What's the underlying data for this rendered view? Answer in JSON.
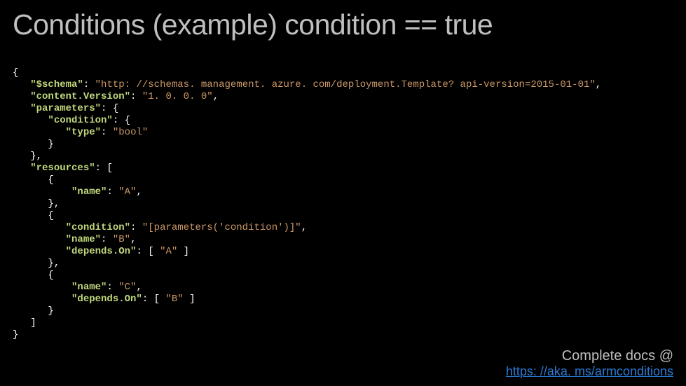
{
  "title": "Conditions  (example) condition == true",
  "code": {
    "lines": [
      [
        {
          "t": "punc",
          "v": "{"
        }
      ],
      [
        {
          "t": "indent",
          "v": "   "
        },
        {
          "t": "key",
          "v": "\"$schema\""
        },
        {
          "t": "punc",
          "v": ": "
        },
        {
          "t": "str",
          "v": "\"http: //schemas. management. azure. com/deployment.Template? api-version=2015-01-01\""
        },
        {
          "t": "punc",
          "v": ","
        }
      ],
      [
        {
          "t": "indent",
          "v": "   "
        },
        {
          "t": "key",
          "v": "\"content.Version\""
        },
        {
          "t": "punc",
          "v": ": "
        },
        {
          "t": "str",
          "v": "\"1. 0. 0. 0\""
        },
        {
          "t": "punc",
          "v": ","
        }
      ],
      [
        {
          "t": "indent",
          "v": "   "
        },
        {
          "t": "key",
          "v": "\"parameters\""
        },
        {
          "t": "punc",
          "v": ": {"
        }
      ],
      [
        {
          "t": "indent",
          "v": "      "
        },
        {
          "t": "key",
          "v": "\"condition\""
        },
        {
          "t": "punc",
          "v": ": {"
        }
      ],
      [
        {
          "t": "indent",
          "v": "         "
        },
        {
          "t": "key",
          "v": "\"type\""
        },
        {
          "t": "punc",
          "v": ": "
        },
        {
          "t": "str",
          "v": "\"bool\""
        }
      ],
      [
        {
          "t": "indent",
          "v": "      "
        },
        {
          "t": "punc",
          "v": "}"
        }
      ],
      [
        {
          "t": "indent",
          "v": "   "
        },
        {
          "t": "punc",
          "v": "},"
        }
      ],
      [
        {
          "t": "indent",
          "v": "   "
        },
        {
          "t": "key",
          "v": "\"resources\""
        },
        {
          "t": "punc",
          "v": ": ["
        }
      ],
      [
        {
          "t": "indent",
          "v": "      "
        },
        {
          "t": "punc",
          "v": "{"
        }
      ],
      [
        {
          "t": "indent",
          "v": "          "
        },
        {
          "t": "key",
          "v": "\"name\""
        },
        {
          "t": "punc",
          "v": ": "
        },
        {
          "t": "str",
          "v": "\"A\""
        },
        {
          "t": "punc",
          "v": ","
        }
      ],
      [
        {
          "t": "indent",
          "v": "      "
        },
        {
          "t": "punc",
          "v": "},"
        }
      ],
      [
        {
          "t": "indent",
          "v": "      "
        },
        {
          "t": "punc",
          "v": "{"
        }
      ],
      [
        {
          "t": "indent",
          "v": "         "
        },
        {
          "t": "key",
          "v": "\"condition\""
        },
        {
          "t": "punc",
          "v": ": "
        },
        {
          "t": "str",
          "v": "\"[parameters('condition')]\""
        },
        {
          "t": "punc",
          "v": ","
        }
      ],
      [
        {
          "t": "indent",
          "v": "         "
        },
        {
          "t": "key",
          "v": "\"name\""
        },
        {
          "t": "punc",
          "v": ": "
        },
        {
          "t": "str",
          "v": "\"B\""
        },
        {
          "t": "punc",
          "v": ","
        }
      ],
      [
        {
          "t": "indent",
          "v": "         "
        },
        {
          "t": "key",
          "v": "\"depends.On\""
        },
        {
          "t": "punc",
          "v": ": [ "
        },
        {
          "t": "str",
          "v": "\"A\""
        },
        {
          "t": "punc",
          "v": " ]"
        }
      ],
      [
        {
          "t": "indent",
          "v": "      "
        },
        {
          "t": "punc",
          "v": "},"
        }
      ],
      [
        {
          "t": "indent",
          "v": "      "
        },
        {
          "t": "punc",
          "v": "{"
        }
      ],
      [
        {
          "t": "indent",
          "v": "          "
        },
        {
          "t": "key",
          "v": "\"name\""
        },
        {
          "t": "punc",
          "v": ": "
        },
        {
          "t": "str",
          "v": "\"C\""
        },
        {
          "t": "punc",
          "v": ","
        }
      ],
      [
        {
          "t": "indent",
          "v": "          "
        },
        {
          "t": "key",
          "v": "\"depends.On\""
        },
        {
          "t": "punc",
          "v": ": [ "
        },
        {
          "t": "str",
          "v": "\"B\""
        },
        {
          "t": "punc",
          "v": " ]"
        }
      ],
      [
        {
          "t": "indent",
          "v": "      "
        },
        {
          "t": "punc",
          "v": "}"
        }
      ],
      [
        {
          "t": "indent",
          "v": "   "
        },
        {
          "t": "punc",
          "v": "]"
        }
      ],
      [
        {
          "t": "punc",
          "v": "}"
        }
      ]
    ]
  },
  "footer": {
    "text": "Complete docs @",
    "link_text": "https: //aka. ms/armconditions"
  }
}
